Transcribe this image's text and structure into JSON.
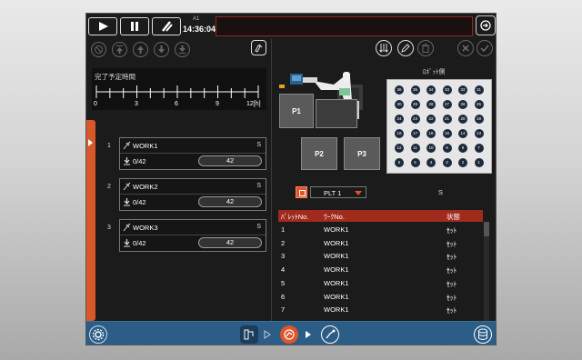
{
  "topbar": {
    "play_icon": "play-icon",
    "pause_icon": "pause-icon",
    "stop_icon": "slash-stop-icon",
    "time_label": "A1",
    "time": "14:36:04",
    "message": ""
  },
  "time_panel": {
    "label": "完了予定時間",
    "ticks": [
      "0",
      "3",
      "6",
      "9",
      "12[h]"
    ]
  },
  "works": [
    {
      "num": "1",
      "name": "WORK1",
      "s": "S",
      "count": "0/42",
      "value": "42"
    },
    {
      "num": "2",
      "name": "WORK2",
      "s": "S",
      "count": "0/42",
      "value": "42"
    },
    {
      "num": "3",
      "name": "WORK3",
      "s": "S",
      "count": "0/42",
      "value": "42"
    }
  ],
  "layout": {
    "p1": "P1",
    "p2": "P2",
    "p3": "P3",
    "plate_label": "ﾛﾎﾞｯﾄ側"
  },
  "plate_holes": [
    "36",
    "35",
    "34",
    "33",
    "32",
    "31",
    "30",
    "29",
    "28",
    "27",
    "26",
    "25",
    "24",
    "23",
    "22",
    "21",
    "20",
    "19",
    "18",
    "17",
    "16",
    "15",
    "14",
    "13",
    "12",
    "11",
    "10",
    "9",
    "8",
    "7",
    "6",
    "5",
    "4",
    "3",
    "2",
    "1"
  ],
  "plt_select": {
    "value": "PLT 1"
  },
  "right_s": "S",
  "table": {
    "headers": [
      "ﾊﾟﾚｯﾄNo.",
      "ﾜｰｸNo.",
      "状態"
    ],
    "rows": [
      [
        "1",
        "WORK1",
        "ｾｯﾄ"
      ],
      [
        "2",
        "WORK1",
        "ｾｯﾄ"
      ],
      [
        "3",
        "WORK1",
        "ｾｯﾄ"
      ],
      [
        "4",
        "WORK1",
        "ｾｯﾄ"
      ],
      [
        "5",
        "WORK1",
        "ｾｯﾄ"
      ],
      [
        "6",
        "WORK1",
        "ｾｯﾄ"
      ],
      [
        "7",
        "WORK1",
        "ｾｯﾄ"
      ]
    ]
  },
  "colors": {
    "accent": "#e0552a",
    "table_header": "#a02a1c",
    "bottom_bar": "#2c5d86"
  }
}
